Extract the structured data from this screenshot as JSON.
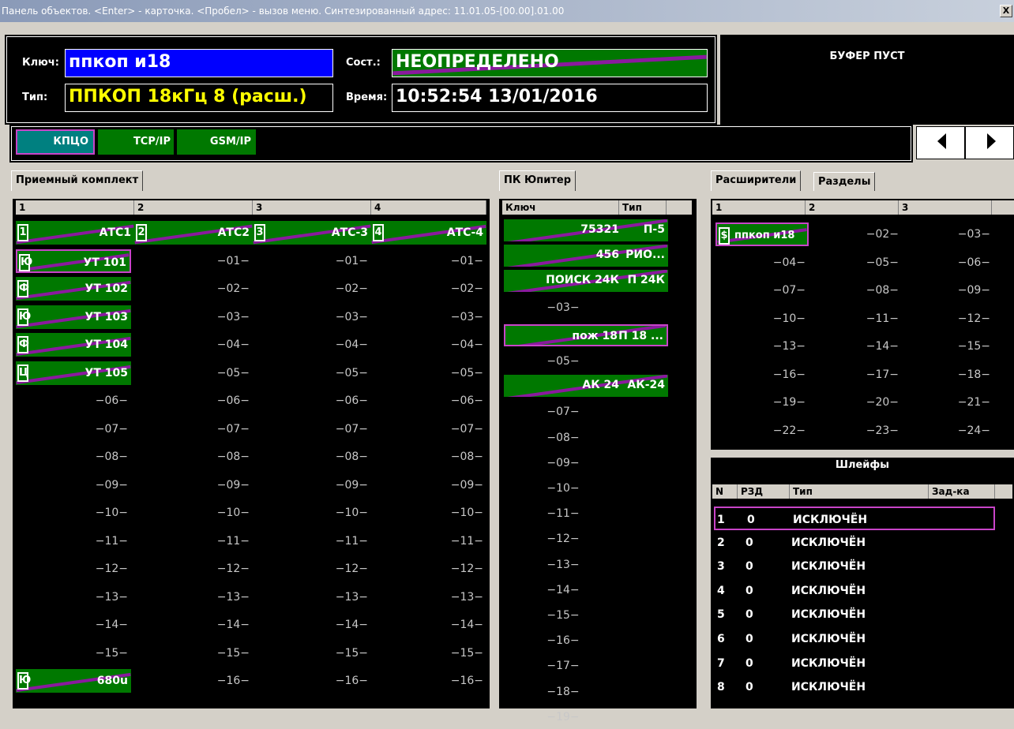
{
  "title": "Панель объектов. <Enter> - карточка. <Пробел> - вызов меню. Синтезированный адрес: 11.01.05-[00.00].01.00",
  "close": "X",
  "info": {
    "key_label": "Ключ:",
    "key_value": "ппкоп и18",
    "type_label": "Тип:",
    "type_value": "ППКОП 18кГц  8 (расш.)",
    "state_label": "Сост.:",
    "state_value": "НЕОПРЕДЕЛЕНО",
    "time_label": "Время:",
    "time_value": "10:52:54 13/01/2016"
  },
  "buffer": "БУФЕР ПУСТ",
  "protocols": [
    "КПЦО",
    "TCP/IP",
    "GSM/IP"
  ],
  "colors": {
    "green": "#007800",
    "purple": "#8a1a9e",
    "selection": "#c844c8",
    "key_blue": "#0000ff",
    "type_yellow": "#ffff00"
  },
  "left": {
    "tab": "Приемный комплект",
    "cols": [
      "1",
      "2",
      "3",
      "4"
    ],
    "row0": [
      {
        "n": "1",
        "t": "АТС1"
      },
      {
        "n": "2",
        "t": "АТС2"
      },
      {
        "n": "3",
        "t": "АТС-3"
      },
      {
        "n": "4",
        "t": "АТС-4"
      }
    ],
    "col1": [
      {
        "n": "Ю",
        "t": "УТ 101",
        "sel": true
      },
      {
        "n": "Ф",
        "t": "УТ 102"
      },
      {
        "n": "Ю",
        "t": "УТ 103"
      },
      {
        "n": "Ф",
        "t": "УТ 104"
      },
      {
        "n": "Ц",
        "t": "УТ 105"
      },
      {
        "t": "−06−"
      },
      {
        "t": "−07−"
      },
      {
        "t": "−08−"
      },
      {
        "t": "−09−"
      },
      {
        "t": "−10−"
      },
      {
        "t": "−11−"
      },
      {
        "t": "−12−"
      },
      {
        "t": "−13−"
      },
      {
        "t": "−14−"
      },
      {
        "t": "−15−"
      },
      {
        "n": "Ю",
        "t": "680u"
      }
    ],
    "cols_empty": [
      "−01−",
      "−02−",
      "−03−",
      "−04−",
      "−05−",
      "−06−",
      "−07−",
      "−08−",
      "−09−",
      "−10−",
      "−11−",
      "−12−",
      "−13−",
      "−14−",
      "−15−",
      "−16−"
    ]
  },
  "mid": {
    "tab": "ПК Юпитер",
    "h_key": "Ключ",
    "h_type": "Тип",
    "rows": [
      {
        "k": "75321",
        "t": "П-5",
        "g": true
      },
      {
        "k": "456",
        "t": "РИО...",
        "g": true
      },
      {
        "k": "ПОИСК 24К",
        "t": "П 24К",
        "g": true
      },
      {
        "k": "−03−"
      },
      {
        "k": "пож 18",
        "t": "П 18 ...",
        "g": true,
        "sel": true
      },
      {
        "k": "−05−"
      },
      {
        "k": "АК 24",
        "t": "АК-24",
        "g": true
      },
      {
        "k": "−07−"
      },
      {
        "k": "−08−"
      },
      {
        "k": "−09−"
      },
      {
        "k": "−10−"
      },
      {
        "k": "−11−"
      },
      {
        "k": "−12−"
      },
      {
        "k": "−13−"
      },
      {
        "k": "−14−"
      },
      {
        "k": "−15−"
      },
      {
        "k": "−16−"
      },
      {
        "k": "−17−"
      },
      {
        "k": "−18−"
      },
      {
        "k": "−19−"
      }
    ]
  },
  "right": {
    "tabs": [
      "Расширители",
      "Разделы"
    ],
    "cols": [
      "1",
      "2",
      "3"
    ],
    "first": {
      "n": "$",
      "t": "ппкоп и18"
    },
    "cells": [
      "−02−",
      "−03−",
      "−04−",
      "−05−",
      "−06−",
      "−07−",
      "−08−",
      "−09−",
      "−10−",
      "−11−",
      "−12−",
      "−13−",
      "−14−",
      "−15−",
      "−16−",
      "−17−",
      "−18−",
      "−19−",
      "−20−",
      "−21−",
      "−22−",
      "−23−",
      "−24−"
    ],
    "loops_title": "Шлейфы",
    "loop_cols": [
      "N",
      "РЗД",
      "Тип",
      "Зад-ка"
    ],
    "loops": [
      {
        "n": "1",
        "r": "0",
        "t": "ИСКЛЮЧЁН"
      },
      {
        "n": "2",
        "r": "0",
        "t": "ИСКЛЮЧЁН"
      },
      {
        "n": "3",
        "r": "0",
        "t": "ИСКЛЮЧЁН"
      },
      {
        "n": "4",
        "r": "0",
        "t": "ИСКЛЮЧЁН"
      },
      {
        "n": "5",
        "r": "0",
        "t": "ИСКЛЮЧЁН"
      },
      {
        "n": "6",
        "r": "0",
        "t": "ИСКЛЮЧЁН"
      },
      {
        "n": "7",
        "r": "0",
        "t": "ИСКЛЮЧЁН"
      },
      {
        "n": "8",
        "r": "0",
        "t": "ИСКЛЮЧЁН"
      }
    ]
  }
}
